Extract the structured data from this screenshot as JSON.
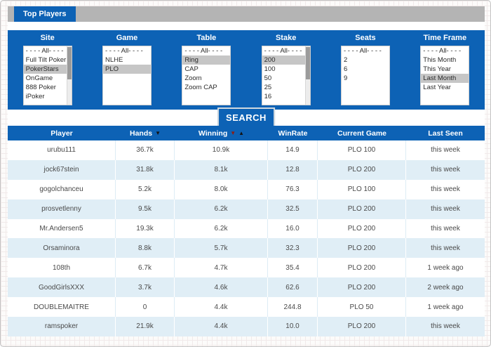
{
  "tab": {
    "label": "Top Players"
  },
  "filters": [
    {
      "label": "Site",
      "options": [
        "- - - - All- - - -",
        "Full Tilt Poker",
        "PokerStars",
        "OnGame",
        "888 Poker",
        "iPoker"
      ],
      "selected_index": 2,
      "scrollbar": true
    },
    {
      "label": "Game",
      "options": [
        "- - - - All- - - -",
        "NLHE",
        "PLO"
      ],
      "selected_index": 2,
      "scrollbar": false
    },
    {
      "label": "Table",
      "options": [
        "- - - - All- - - -",
        "Ring",
        "CAP",
        "Zoom",
        "Zoom CAP"
      ],
      "selected_index": 1,
      "scrollbar": false
    },
    {
      "label": "Stake",
      "options": [
        "- - - - All- - - -",
        "200",
        "100",
        "50",
        "25",
        "16"
      ],
      "selected_index": 1,
      "scrollbar": true
    },
    {
      "label": "Seats",
      "options": [
        "- - - - All- - - -",
        "2",
        "6",
        "9"
      ],
      "selected_index": -1,
      "scrollbar": false
    },
    {
      "label": "Time Frame",
      "options": [
        "- - - - All- - - -",
        "This Month",
        "This Year",
        "Last Month",
        "Last Year"
      ],
      "selected_index": 3,
      "scrollbar": false
    }
  ],
  "search": {
    "button_label": "SEARCH"
  },
  "table": {
    "columns": [
      {
        "label": "Player",
        "sort": []
      },
      {
        "label": "Hands",
        "sort": [
          {
            "dir": "desc",
            "tone": "dark"
          }
        ]
      },
      {
        "label": "Winning",
        "sort": [
          {
            "dir": "desc",
            "tone": "red"
          },
          {
            "dir": "asc",
            "tone": "dark"
          }
        ]
      },
      {
        "label": "WinRate",
        "sort": []
      },
      {
        "label": "Current Game",
        "sort": []
      },
      {
        "label": "Last Seen",
        "sort": []
      }
    ],
    "rows": [
      {
        "player": "urubu111",
        "hands": "36.7k",
        "winning": "10.9k",
        "winrate": "14.9",
        "current_game": "PLO 100",
        "last_seen": "this week"
      },
      {
        "player": "jock67stein",
        "hands": "31.8k",
        "winning": "8.1k",
        "winrate": "12.8",
        "current_game": "PLO 200",
        "last_seen": "this week"
      },
      {
        "player": "gogolchanceu",
        "hands": "5.2k",
        "winning": "8.0k",
        "winrate": "76.3",
        "current_game": "PLO 100",
        "last_seen": "this week"
      },
      {
        "player": "prosvetlenny",
        "hands": "9.5k",
        "winning": "6.2k",
        "winrate": "32.5",
        "current_game": "PLO 200",
        "last_seen": "this week"
      },
      {
        "player": "Mr.Andersen5",
        "hands": "19.3k",
        "winning": "6.2k",
        "winrate": "16.0",
        "current_game": "PLO 200",
        "last_seen": "this week"
      },
      {
        "player": "Orsaminora",
        "hands": "8.8k",
        "winning": "5.7k",
        "winrate": "32.3",
        "current_game": "PLO 200",
        "last_seen": "this week"
      },
      {
        "player": "108th",
        "hands": "6.7k",
        "winning": "4.7k",
        "winrate": "35.4",
        "current_game": "PLO 200",
        "last_seen": "1 week ago"
      },
      {
        "player": "GoodGirlsXXX",
        "hands": "3.7k",
        "winning": "4.6k",
        "winrate": "62.6",
        "current_game": "PLO 200",
        "last_seen": "2 week ago"
      },
      {
        "player": "DOUBLEMAITRE",
        "hands": "0",
        "winning": "4.4k",
        "winrate": "244.8",
        "current_game": "PLO 50",
        "last_seen": "1 week ago"
      },
      {
        "player": "ramspoker",
        "hands": "21.9k",
        "winning": "4.4k",
        "winrate": "10.0",
        "current_game": "PLO 200",
        "last_seen": "this week"
      }
    ]
  },
  "colors": {
    "primary_blue": "#0d62b5",
    "tab_bar_gray": "#b4b4b4",
    "selected_option_gray": "#c6c6c6",
    "alt_row_blue": "#e0eef6",
    "sort_desc_red": "#8e1c10",
    "sort_dark": "#131313"
  }
}
